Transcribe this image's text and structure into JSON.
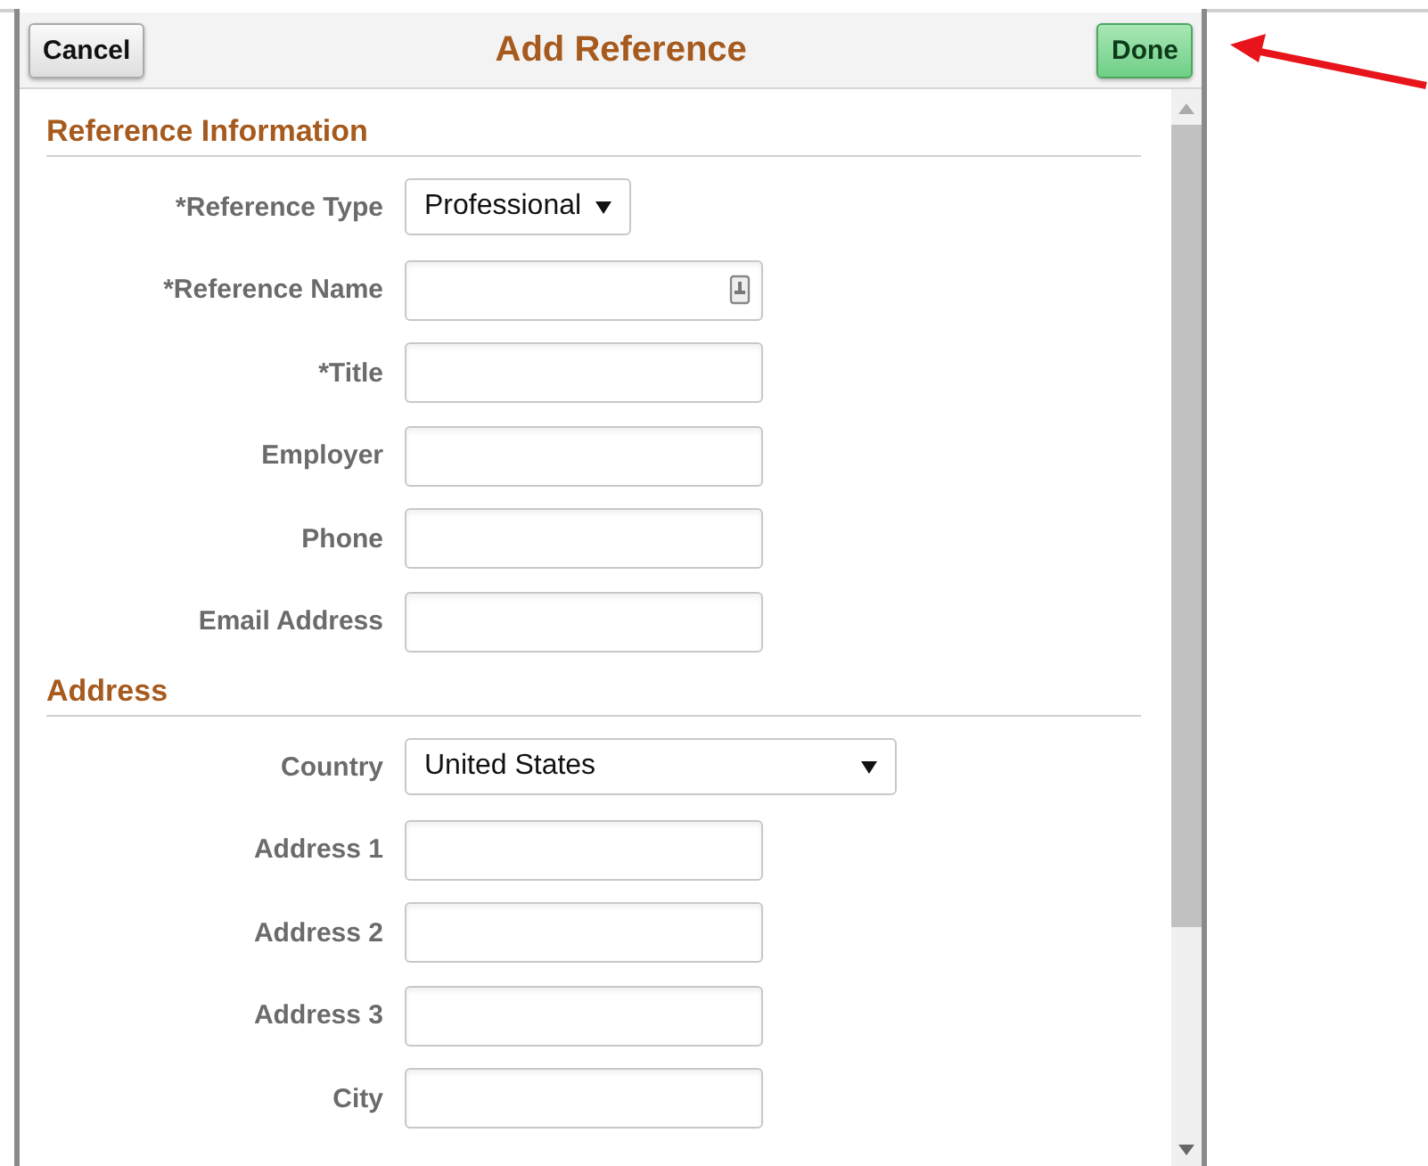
{
  "header": {
    "cancel": "Cancel",
    "title": "Add Reference",
    "done": "Done"
  },
  "sections": [
    {
      "title": "Reference Information",
      "fields": [
        {
          "kind": "select",
          "label": "*Reference Type",
          "value": "Professional"
        },
        {
          "kind": "lookup",
          "label": "*Reference Name"
        },
        {
          "kind": "text",
          "label": "*Title"
        },
        {
          "kind": "text",
          "label": "Employer"
        },
        {
          "kind": "text",
          "label": "Phone"
        },
        {
          "kind": "text",
          "label": "Email Address"
        }
      ]
    },
    {
      "title": "Address",
      "fields": [
        {
          "kind": "wideselect",
          "label": "Country",
          "value": "United States"
        },
        {
          "kind": "text",
          "label": "Address 1"
        },
        {
          "kind": "text",
          "label": "Address 2"
        },
        {
          "kind": "text",
          "label": "Address 3"
        },
        {
          "kind": "text",
          "label": "City"
        }
      ]
    }
  ]
}
